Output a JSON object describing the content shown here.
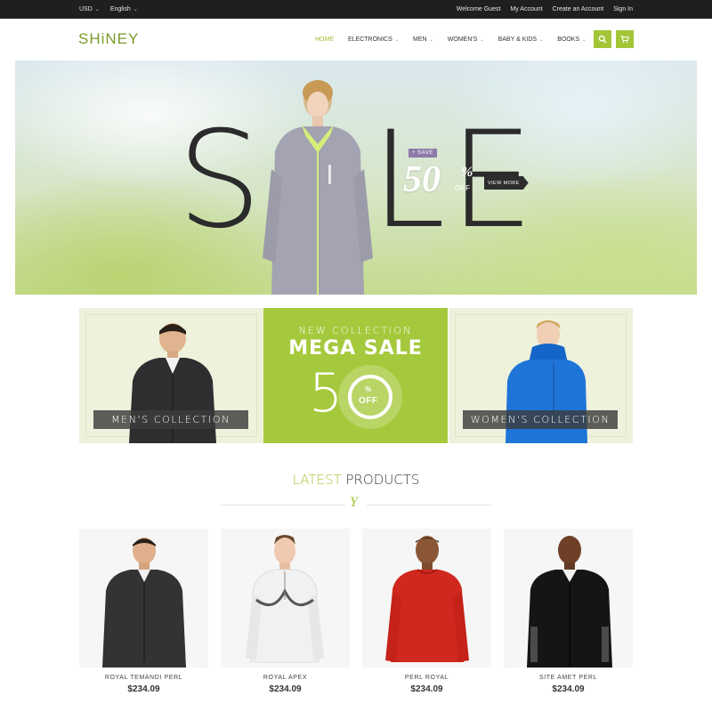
{
  "topbar": {
    "currency": "USD",
    "language": "English",
    "links": [
      "Welcome Guest",
      "My Account",
      "Create an Account",
      "Sign In"
    ]
  },
  "header": {
    "logo": "SHiNEY",
    "nav": [
      {
        "label": "HOME",
        "active": true,
        "dropdown": false
      },
      {
        "label": "ELECTRONICS",
        "active": false,
        "dropdown": true
      },
      {
        "label": "MEN",
        "active": false,
        "dropdown": true
      },
      {
        "label": "WOMEN'S",
        "active": false,
        "dropdown": true
      },
      {
        "label": "BABY & KIDS",
        "active": false,
        "dropdown": true
      },
      {
        "label": "BOOKS",
        "active": false,
        "dropdown": true
      }
    ],
    "search_icon": "search-icon",
    "cart_icon": "cart-icon"
  },
  "hero": {
    "letters": [
      "S",
      "L",
      "E"
    ],
    "save_tag": "+ SAVE",
    "save_number": "50",
    "save_percent": "%",
    "save_off": "OFF",
    "view_more": "VIEW MORE"
  },
  "promos": {
    "men_label": "MEN'S COLLECTION",
    "women_label": "WOMEN'S COLLECTION",
    "new_collection": "NEW COLLECTION",
    "mega_sale": "MEGA SALE",
    "five": "5",
    "percent": "%",
    "off": "OFF"
  },
  "latest": {
    "accent": "LATEST",
    "rest": " PRODUCTS",
    "divider_icon": "Y"
  },
  "products": [
    {
      "name": "ROYAL TEMANDI PERL",
      "price": "$234.09",
      "garment": "dark-fleece"
    },
    {
      "name": "ROYAL APEX",
      "price": "$234.09",
      "garment": "white-jacket"
    },
    {
      "name": "PERL ROYAL",
      "price": "$234.09",
      "garment": "red-sweater"
    },
    {
      "name": "SITE AMET PERL",
      "price": "$234.09",
      "garment": "black-fleece"
    }
  ],
  "colors": {
    "accent": "#a3c637",
    "topbar": "#1f1f1f",
    "mega_sale_bg": "#a5c93c"
  }
}
